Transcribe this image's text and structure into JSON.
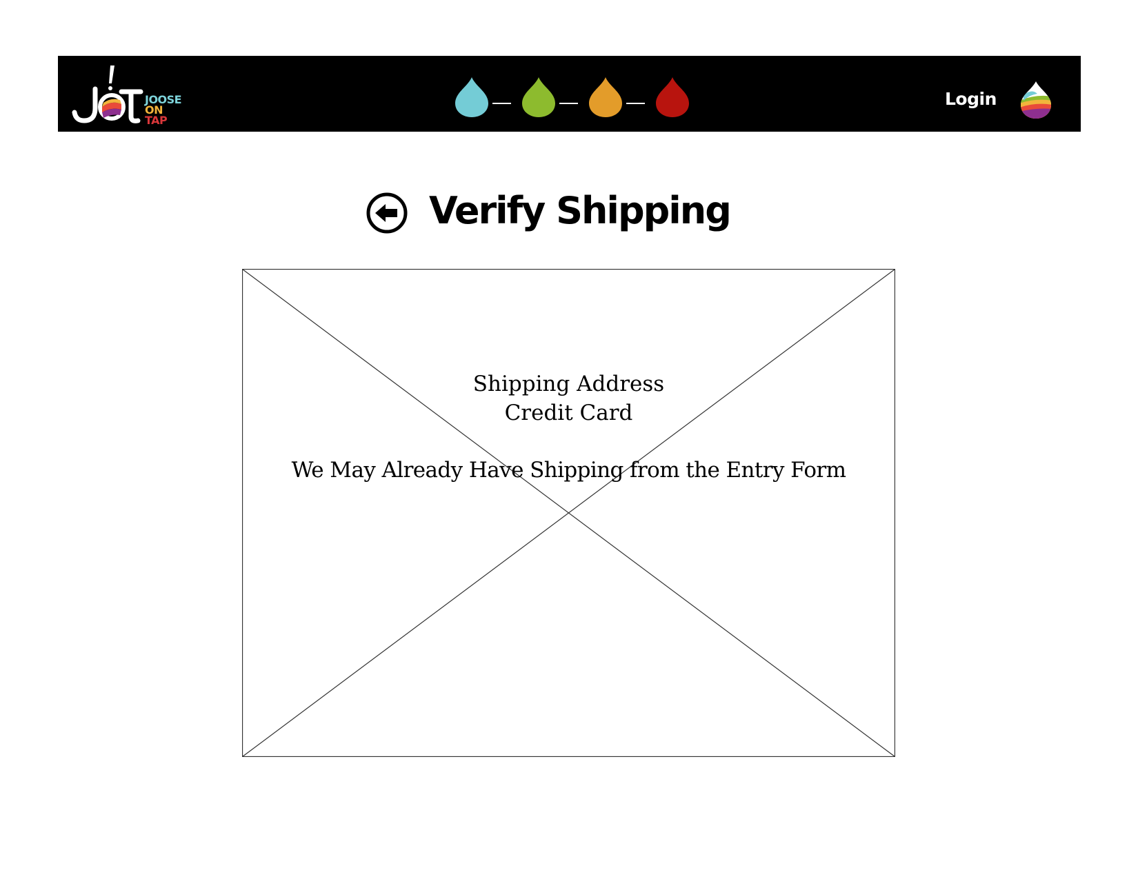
{
  "header": {
    "logo": {
      "mark_text": "JOT",
      "words": [
        "JOOSE",
        "ON",
        "TAP"
      ],
      "word_colors": [
        "#7dd3da",
        "#f2b43c",
        "#d9373a"
      ]
    },
    "steps": {
      "colors": [
        "#74ccd6",
        "#8dbb2e",
        "#e39c2a",
        "#b8140e"
      ],
      "connector_color": "#ffffff"
    },
    "login_label": "Login",
    "profile_icon": "rainbow-drop-icon"
  },
  "page": {
    "back_icon": "arrow-left-circle-icon",
    "title": "Verify Shipping"
  },
  "placeholder": {
    "line1": "Shipping Address",
    "line2": "Credit Card",
    "note": "We May Already Have Shipping from the Entry Form"
  }
}
